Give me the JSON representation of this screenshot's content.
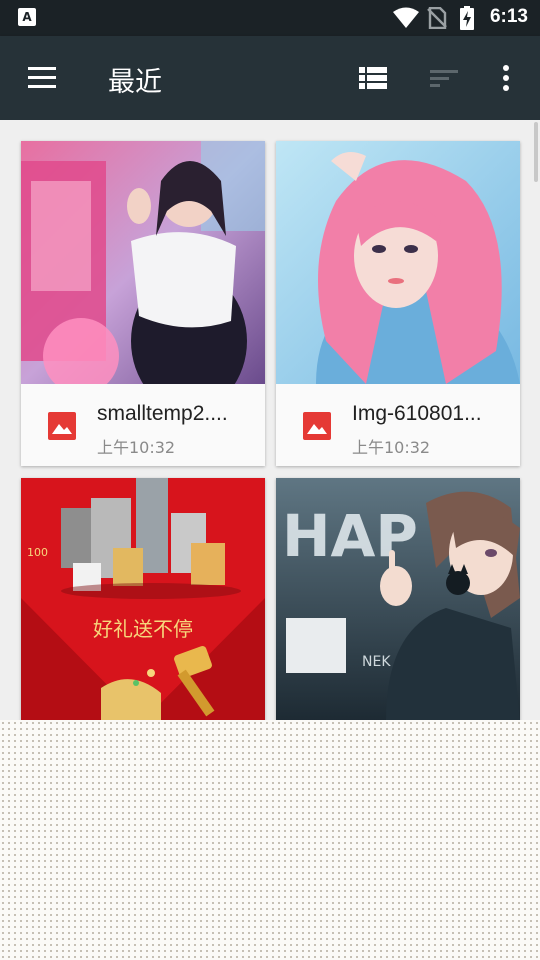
{
  "status_bar": {
    "notification_icon": "A",
    "time": "6:13",
    "icons": [
      "wifi-icon",
      "no-sim-icon",
      "battery-charging-icon"
    ]
  },
  "app_bar": {
    "title": "最近",
    "actions": [
      "menu-icon",
      "list-view-icon",
      "sort-icon",
      "more-vert-icon"
    ]
  },
  "files": [
    {
      "name": "smalltemp2....",
      "time": "上午10:32",
      "icon": "image-icon"
    },
    {
      "name": "Img-610801...",
      "time": "上午10:32",
      "icon": "image-icon"
    },
    {
      "name": "",
      "time": "",
      "icon": "image-icon"
    },
    {
      "name": "",
      "time": "",
      "icon": "image-icon"
    }
  ],
  "thumb_text": {
    "promo": "好礼送不停",
    "promo_badge": "100",
    "poster_big": "HAP",
    "poster_small": "NEK"
  },
  "colors": {
    "status_bar": "#1b2226",
    "app_bar": "#263238",
    "image_icon": "#e53935",
    "background": "#efefef"
  }
}
